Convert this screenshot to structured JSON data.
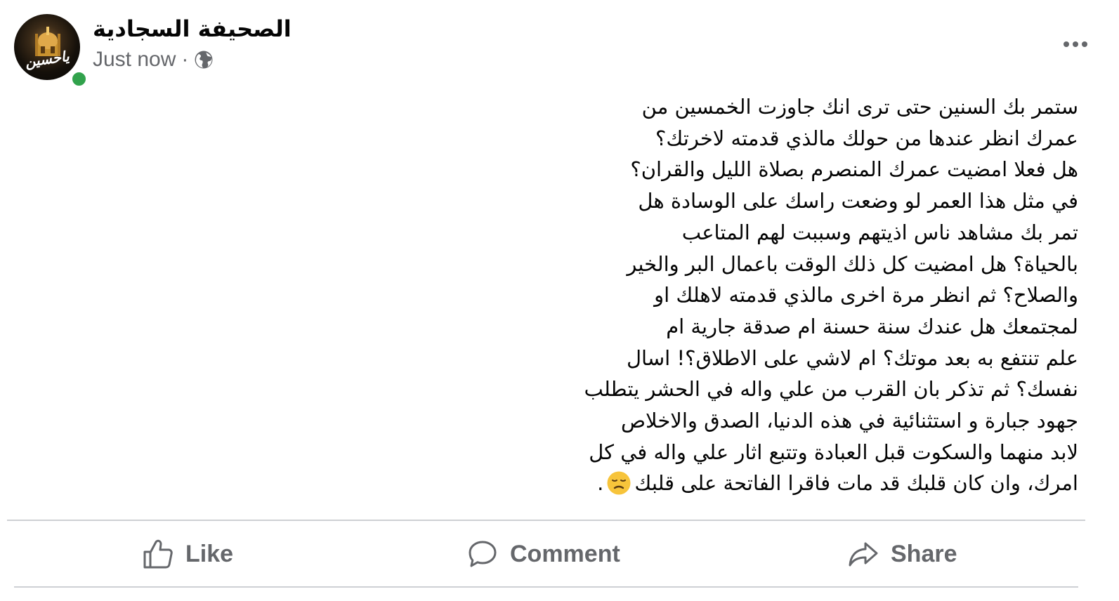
{
  "post": {
    "page_name": "الصحيفة السجادية",
    "avatar_text": "ياحسين",
    "timestamp": "Just now",
    "separator": "·",
    "privacy_icon": "globe-icon",
    "more_icon": "more-options-icon",
    "body_lines": [
      "ستمر بك السنين حتى ترى انك جاوزت الخمسين من",
      "عمرك انظر عندها من حولك مالذي قدمته لاخرتك؟",
      "هل فعلا امضيت عمرك المنصرم بصلاة الليل والقران؟",
      "في مثل هذا العمر لو وضعت راسك على الوسادة هل",
      "تمر بك مشاهد ناس اذيتهم وسببت لهم المتاعب",
      "بالحياة؟ هل امضيت كل ذلك الوقت باعمال البر والخير",
      "والصلاح؟ ثم انظر مرة اخرى مالذي قدمته لاهلك او",
      "لمجتمعك هل عندك سنة حسنة ام صدقة جارية ام",
      "علم تنتفع به بعد موتك؟ ام لاشي على الاطلاق؟! اسال",
      "نفسك؟ ثم تذكر بان القرب من علي واله في الحشر يتطلب",
      "جهود جبارة و استثنائية في هذه الدنيا، الصدق والاخلاص",
      "لابد منهما والسكوت قبل العبادة وتتبع اثار علي واله في كل",
      "امرك، وان كان قلبك قد مات فاقرا الفاتحة على قلبك"
    ],
    "body_end": ".",
    "emoji": "disappointed-face-emoji"
  },
  "actions": {
    "like_label": "Like",
    "comment_label": "Comment",
    "share_label": "Share"
  },
  "colors": {
    "text_primary": "#050505",
    "text_secondary": "#65676b",
    "online_green": "#31a24c",
    "divider": "#ced0d4"
  }
}
